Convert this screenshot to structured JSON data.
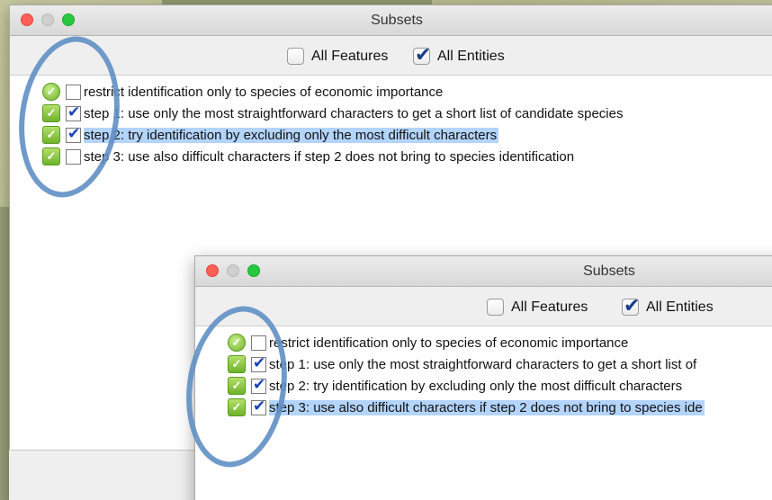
{
  "windows": [
    {
      "title": "Subsets",
      "options": [
        {
          "label": "All Features",
          "checked": false
        },
        {
          "label": "All Entities",
          "checked": true
        }
      ],
      "rows": [
        {
          "text": "restrict identification only to species of economic importance",
          "icon": "round",
          "checked": false,
          "selected": false
        },
        {
          "text": "step 1: use only the most straightforward characters to get a short list of candidate species",
          "icon": "square",
          "checked": true,
          "selected": false
        },
        {
          "text": "step 2: try identification by excluding only the most difficult characters",
          "icon": "square",
          "checked": true,
          "selected": true
        },
        {
          "text": "step 3: use also difficult characters if step 2 does not bring to species identification",
          "icon": "square",
          "checked": false,
          "selected": false
        }
      ]
    },
    {
      "title": "Subsets",
      "options": [
        {
          "label": "All Features",
          "checked": false
        },
        {
          "label": "All Entities",
          "checked": true
        }
      ],
      "rows": [
        {
          "text": "restrict identification only to species of economic importance",
          "icon": "round",
          "checked": false,
          "selected": false
        },
        {
          "text": "step 1: use only the most straightforward characters to get a short list of",
          "icon": "square",
          "checked": true,
          "selected": false
        },
        {
          "text": "step 2: try identification by excluding only the most difficult characters",
          "icon": "square",
          "checked": true,
          "selected": false
        },
        {
          "text": "step 3: use also difficult characters if step 2 does not bring to species ide",
          "icon": "square",
          "checked": true,
          "selected": true
        }
      ]
    }
  ],
  "colors": {
    "selection": "#b3d4fc",
    "annotation": "#5f8fc4",
    "check": "#1942b8",
    "status_green": "#6fb22a"
  },
  "icons": {
    "round_status": "green-check-circle-icon",
    "square_status": "green-check-square-icon"
  }
}
